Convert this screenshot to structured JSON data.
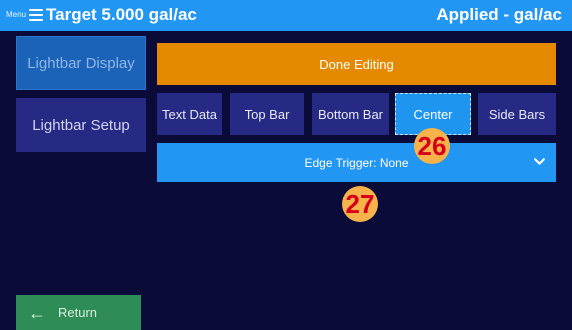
{
  "header": {
    "menu_label": "Menu",
    "target": "Target 5.000 gal/ac",
    "applied": "Applied - gal/ac"
  },
  "sidebar": {
    "items": [
      {
        "label": "Lightbar Display"
      },
      {
        "label": "Lightbar Setup"
      }
    ],
    "return_label": "Return"
  },
  "main": {
    "done_label": "Done Editing",
    "tabs": [
      {
        "label": "Text Data"
      },
      {
        "label": "Top Bar"
      },
      {
        "label": "Bottom Bar"
      },
      {
        "label": "Center"
      },
      {
        "label": "Side Bars"
      }
    ],
    "active_tab": "Center",
    "edge_trigger": "Edge Trigger: None"
  },
  "annotations": [
    "26",
    "27"
  ],
  "colors": {
    "background": "#0b0b3a",
    "header": "#2196f3",
    "done_button": "#e58a00",
    "tab": "#262a85",
    "active_tab": "#1e95ee",
    "return_button": "#2e8c57",
    "badge": "#f7b34a",
    "badge_text": "#d6001c"
  },
  "icons": {
    "menu": "hamburger-icon",
    "return": "arrow-left-icon",
    "dropdown": "chevron-down-icon"
  }
}
